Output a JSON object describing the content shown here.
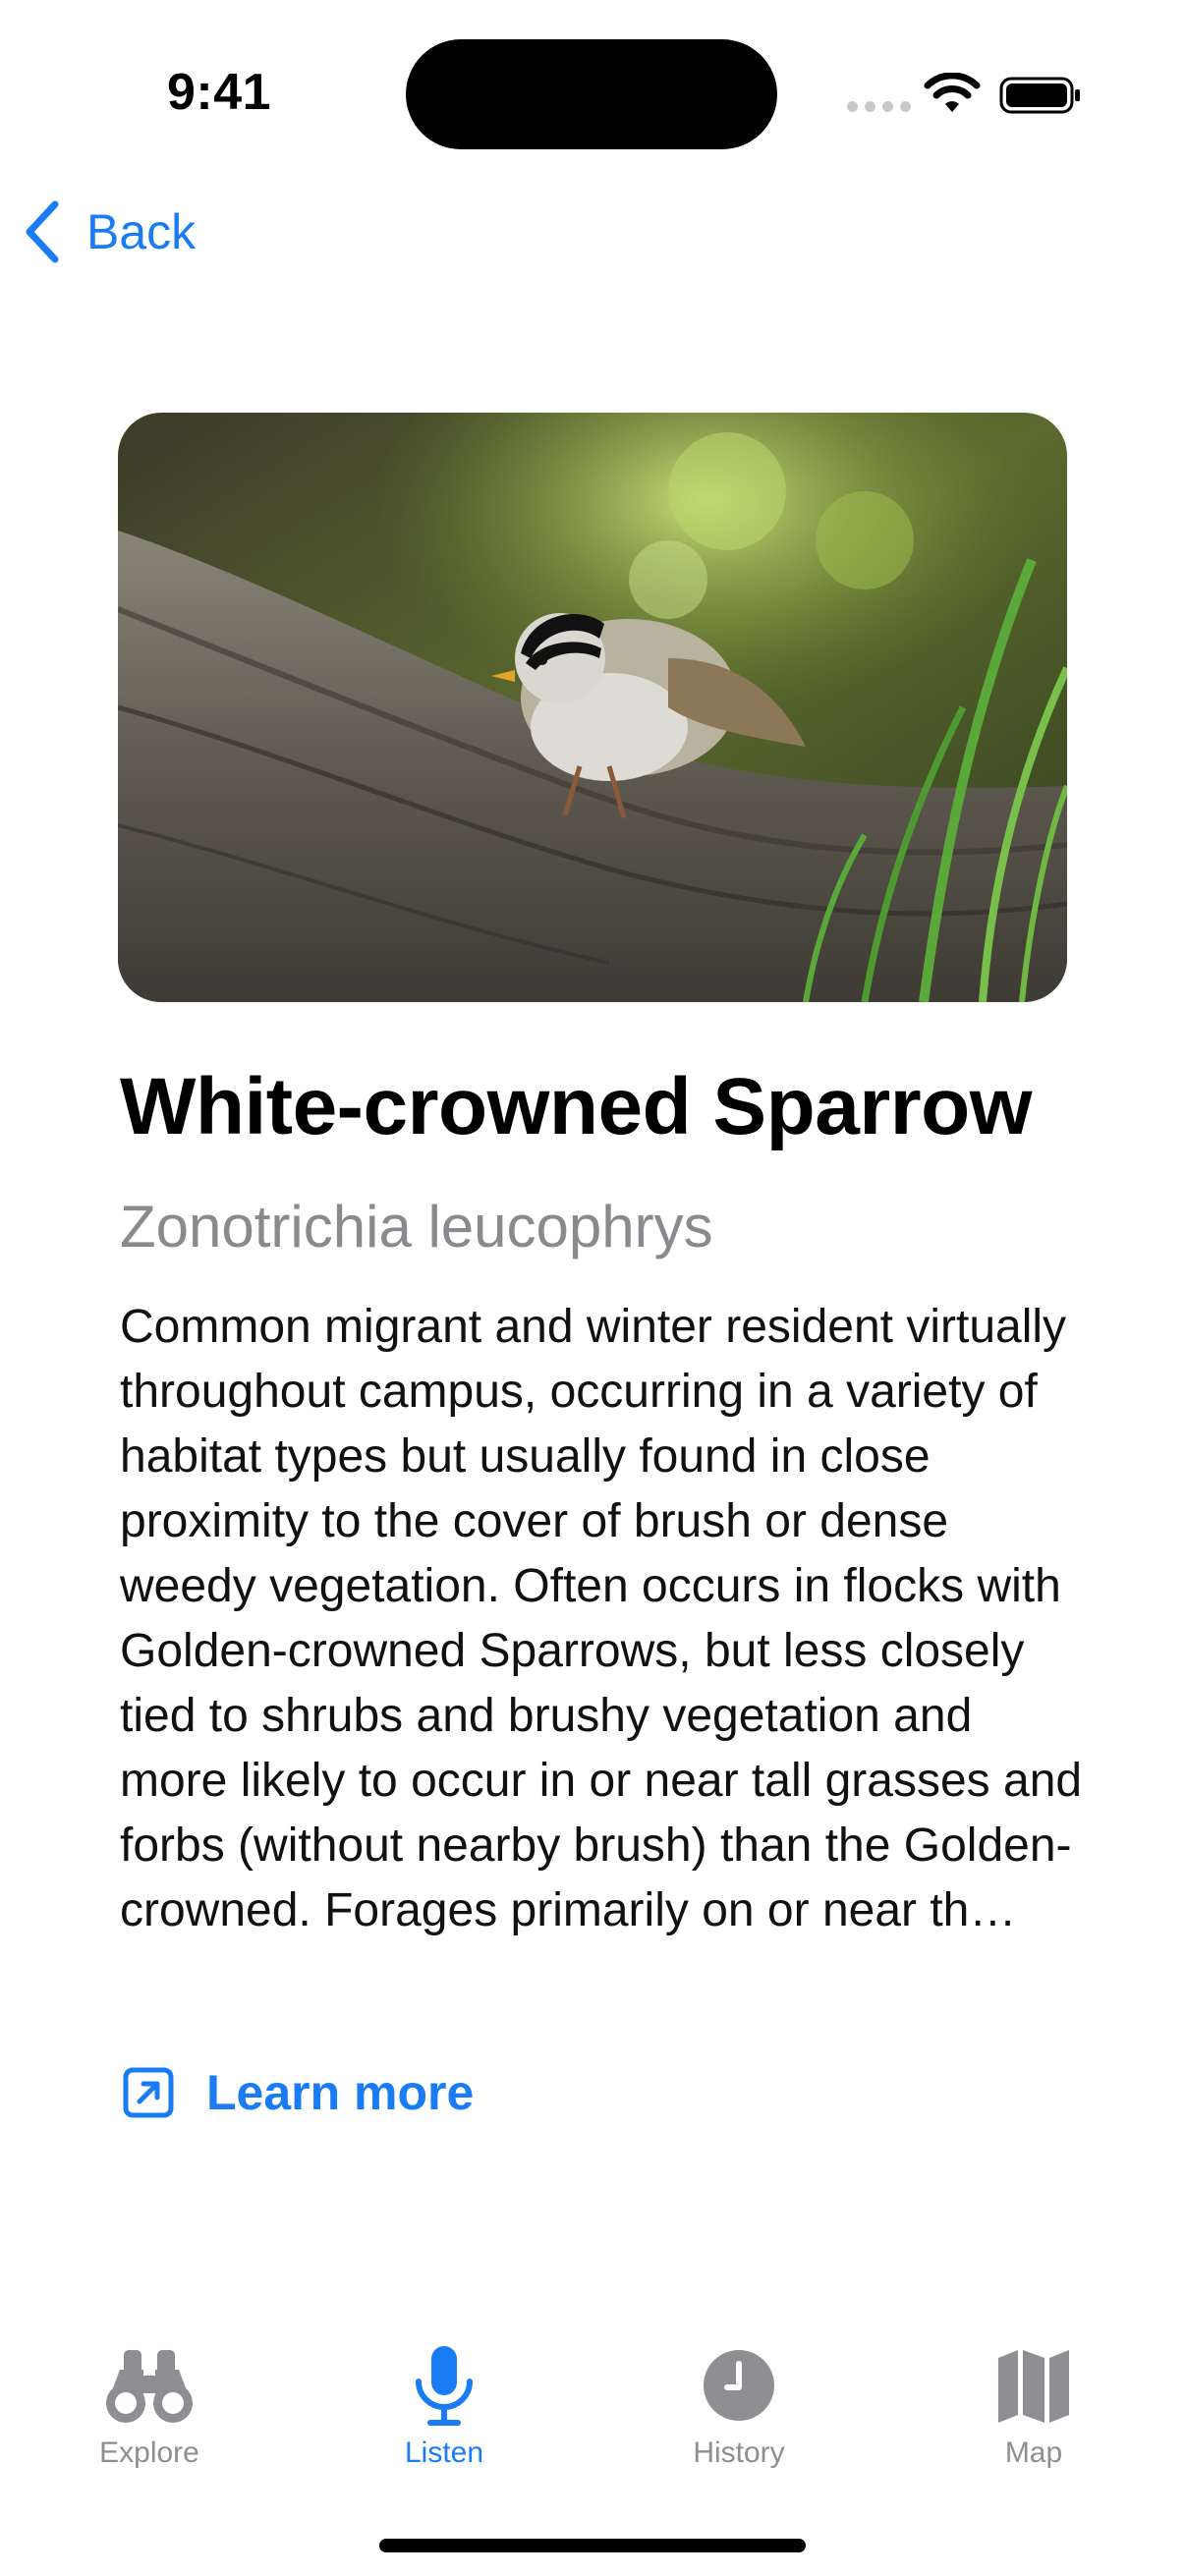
{
  "status_bar": {
    "time": "9:41"
  },
  "nav": {
    "back_label": "Back"
  },
  "bird": {
    "common_name": "White-crowned Sparrow",
    "scientific_name": "Zonotrichia leucophrys",
    "description": "Common migrant and winter resident virtually throughout campus, occurring in a variety of habitat types but usually found in close proximity to the cover of brush or dense weedy vegetation. Often occurs in flocks with Golden-crowned Sparrows, but less closely tied to shrubs and brushy vegetation and more likely to occur in or near tall grasses and forbs (without nearby brush) than the Golden-crowned. Forages primarily on or near th…",
    "learn_more_label": "Learn more"
  },
  "tab_bar": {
    "active_tab": "Listen",
    "tabs": [
      {
        "label": "Explore",
        "icon": "binoculars-icon"
      },
      {
        "label": "Listen",
        "icon": "microphone-icon"
      },
      {
        "label": "History",
        "icon": "clock-icon"
      },
      {
        "label": "Map",
        "icon": "map-icon"
      }
    ]
  },
  "colors": {
    "accent": "#1a7cf5",
    "inactive": "#8e8e93",
    "secondary_text": "#8a8a8e"
  }
}
